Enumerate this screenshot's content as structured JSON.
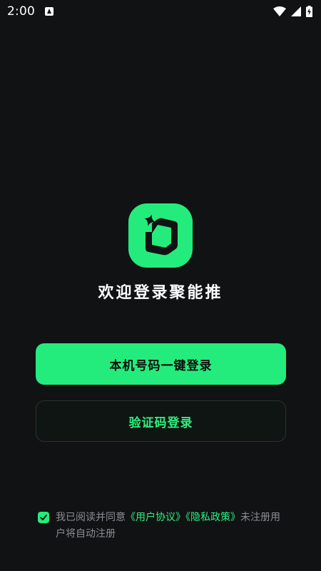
{
  "status_bar": {
    "time": "2:00",
    "icons": [
      "notification-a-icon",
      "wifi-icon",
      "signal-icon",
      "battery-charging-icon"
    ]
  },
  "logo": {
    "icon": "app-logo-icon",
    "bg_color": "#24ec7c",
    "fg_color": "#111214"
  },
  "welcome": {
    "title": "欢迎登录聚能推"
  },
  "buttons": {
    "one_click_login": "本机号码一键登录",
    "sms_login": "验证码登录"
  },
  "agreement": {
    "checked": true,
    "prefix": "我已阅读并同意",
    "user_agreement": "《用户协议》",
    "privacy_policy": "《隐私政策》",
    "suffix": "未注册用户将自动注册"
  },
  "colors": {
    "accent": "#24ec7c",
    "background": "#111214",
    "muted_text": "#8a8d92"
  }
}
